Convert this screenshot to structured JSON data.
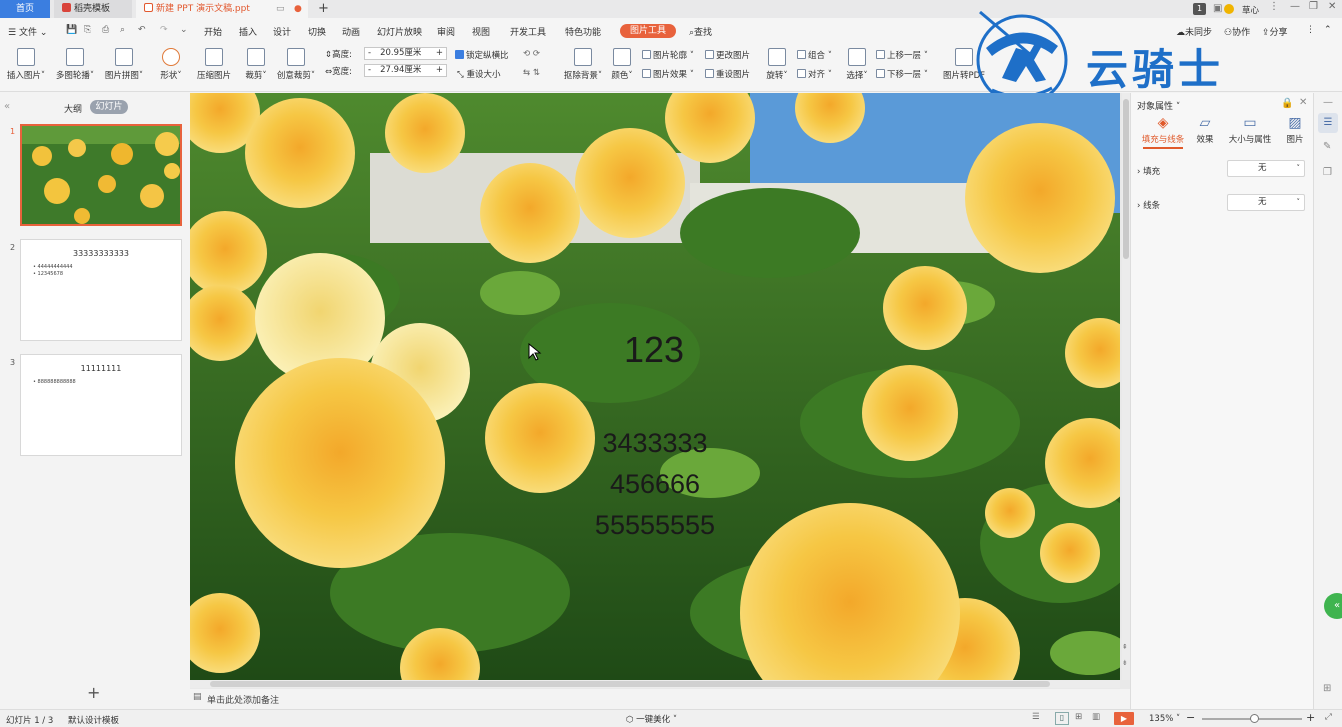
{
  "titlebar": {
    "home_tab": "首页",
    "template_tab": "稻壳模板",
    "doc_tab": "新建 PPT 演示文稿.ppt",
    "new_tab": "+",
    "badge": "1",
    "user": "草心"
  },
  "menu": {
    "file": "文件",
    "items": [
      "开始",
      "插入",
      "设计",
      "切换",
      "动画",
      "幻灯片放映",
      "审阅",
      "视图",
      "开发工具",
      "特色功能"
    ],
    "picture_tools": "图片工具",
    "search": "查找",
    "sync": "未同步",
    "collab": "协作",
    "share": "分享"
  },
  "ribbon": {
    "insert_picture": "插入图片",
    "multi_outline": "多图轮播",
    "collage": "图片拼图",
    "shape": "形状",
    "compress": "压缩图片",
    "crop": "裁剪",
    "creative_crop": "创意裁剪",
    "height_label": "高度:",
    "height_value": "20.95厘米",
    "width_label": "宽度:",
    "width_value": "27.94厘米",
    "lock_ratio": "锁定纵横比",
    "reset_size": "重设大小",
    "remove_bg": "抠除背景",
    "color": "颜色",
    "pic_outline": "图片轮廓",
    "pic_effect": "图片效果",
    "change_pic": "更改图片",
    "reset_pic": "重设图片",
    "rotate": "旋转",
    "group": "组合",
    "align": "对齐",
    "select": "选择",
    "bring_forward": "上移一层",
    "send_backward": "下移一层",
    "pic_to_pdf": "图片转PDF"
  },
  "watermark": {
    "text": "云骑士"
  },
  "left_panel": {
    "tab_outline": "大纲",
    "tab_slides": "幻灯片",
    "slides": [
      {
        "num": "1"
      },
      {
        "num": "2",
        "title": "33333333333",
        "bullets": [
          "44444444444",
          "12345678"
        ]
      },
      {
        "num": "3",
        "title": "11111111",
        "bullets": [
          "888888888888"
        ]
      }
    ],
    "add": "+"
  },
  "slide": {
    "title": "123",
    "lines": [
      "3433333",
      "456666",
      "55555555"
    ]
  },
  "notes": {
    "placeholder": "单击此处添加备注"
  },
  "right_panel": {
    "title": "对象属性",
    "tabs": [
      "填充与线条",
      "效果",
      "大小与属性",
      "图片"
    ],
    "fill_label": "填充",
    "fill_value": "无",
    "line_label": "线条",
    "line_value": "无"
  },
  "status": {
    "slide_count": "幻灯片 1 / 3",
    "template": "默认设计模板",
    "beautify": "一键美化",
    "zoom": "135%"
  },
  "colors": {
    "accent": "#3b7ee0",
    "picture_tools": "#e8623c",
    "fill_tab": "#e05a2b"
  }
}
